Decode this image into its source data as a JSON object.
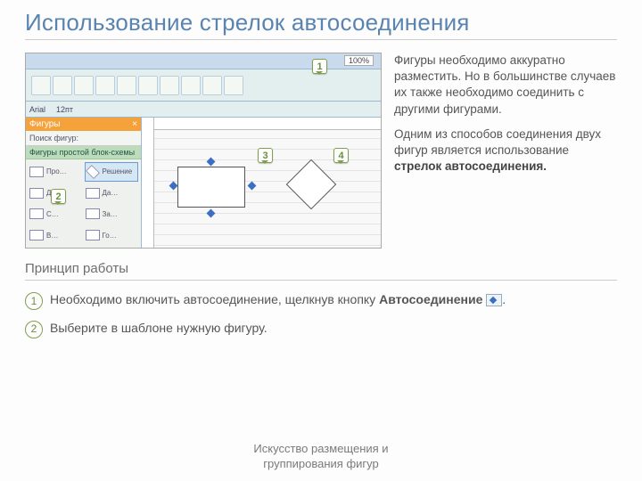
{
  "title": "Использование стрелок автосоединения",
  "screenshot": {
    "zoom": "100%",
    "shapes_panel_title": "Фигуры",
    "search_label": "Поиск фигур:",
    "category": "Фигуры простой блок-схемы",
    "shape_items": [
      "Про…",
      "Решение",
      "Д…",
      "Да…",
      "С…",
      "За…",
      "В…",
      "Го…"
    ],
    "callouts": {
      "c1": "1",
      "c2": "2",
      "c3": "3",
      "c4": "4"
    },
    "toolbar_labels": [
      "Arial",
      "12пт"
    ]
  },
  "paragraphs": {
    "p1": "Фигуры необходимо аккуратно разместить. Но в большинстве случаев их также необходимо соединить с другими фигурами.",
    "p2_a": "Одним из способов соединения двух фигур является использование ",
    "p2_b": "стрелок автосоединения."
  },
  "section_heading": "Принцип работы",
  "steps": {
    "s1_a": "Необходимо включить автосоединение, щелкнув кнопку ",
    "s1_b": "Автосоединение",
    "s1_c": ".",
    "s2": "Выберите в шаблоне нужную фигуру."
  },
  "footer": {
    "l1": "Искусство размещения и",
    "l2": "группирования фигур"
  }
}
